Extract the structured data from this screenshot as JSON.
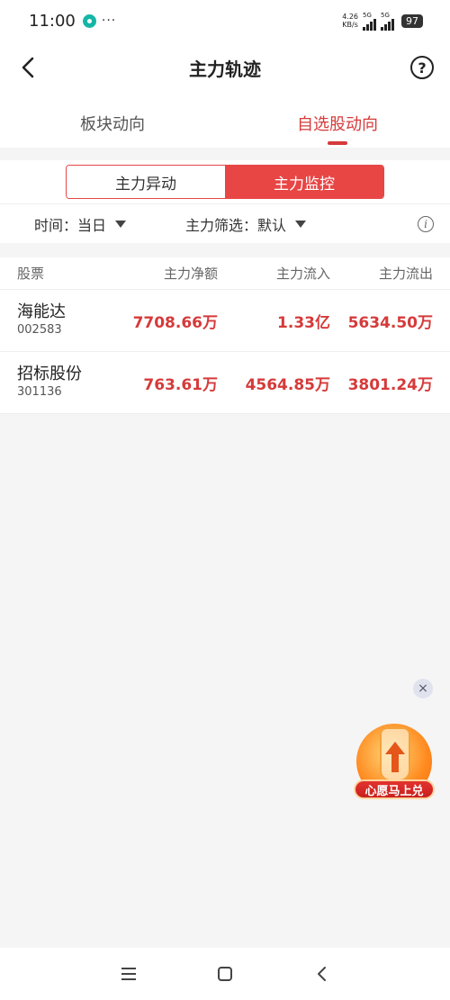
{
  "status_bar": {
    "time": "11:00",
    "dots": "···",
    "net_speed_value": "4.26",
    "net_speed_unit": "KB/s",
    "sig1_label": "5G",
    "sig2_label": "5G",
    "battery": "97"
  },
  "header": {
    "title": "主力轨迹"
  },
  "tabs": [
    {
      "label": "板块动向",
      "active": false
    },
    {
      "label": "自选股动向",
      "active": true
    }
  ],
  "segment": {
    "options": [
      "主力异动",
      "主力监控"
    ],
    "selected": "主力监控"
  },
  "filters": {
    "time_label": "时间：当日",
    "filter_label": "主力筛选：默认"
  },
  "table": {
    "headers": [
      "股票",
      "主力净额",
      "主力流入",
      "主力流出"
    ],
    "rows": [
      {
        "name": "海能达",
        "code": "002583",
        "net": "7708.66万",
        "inflow": "1.33亿",
        "outflow": "5634.50万"
      },
      {
        "name": "招标股份",
        "code": "301136",
        "net": "763.61万",
        "inflow": "4564.85万",
        "outflow": "3801.24万"
      }
    ]
  },
  "promo": {
    "label": "心愿马上兑",
    "close": "×"
  },
  "colors": {
    "accent": "#e84545",
    "up_red": "#d63a3a"
  },
  "icons": [
    "back-arrow-icon",
    "help-icon",
    "caret-down-icon",
    "info-icon",
    "close-icon",
    "menu-icon",
    "home-icon",
    "back-icon"
  ]
}
